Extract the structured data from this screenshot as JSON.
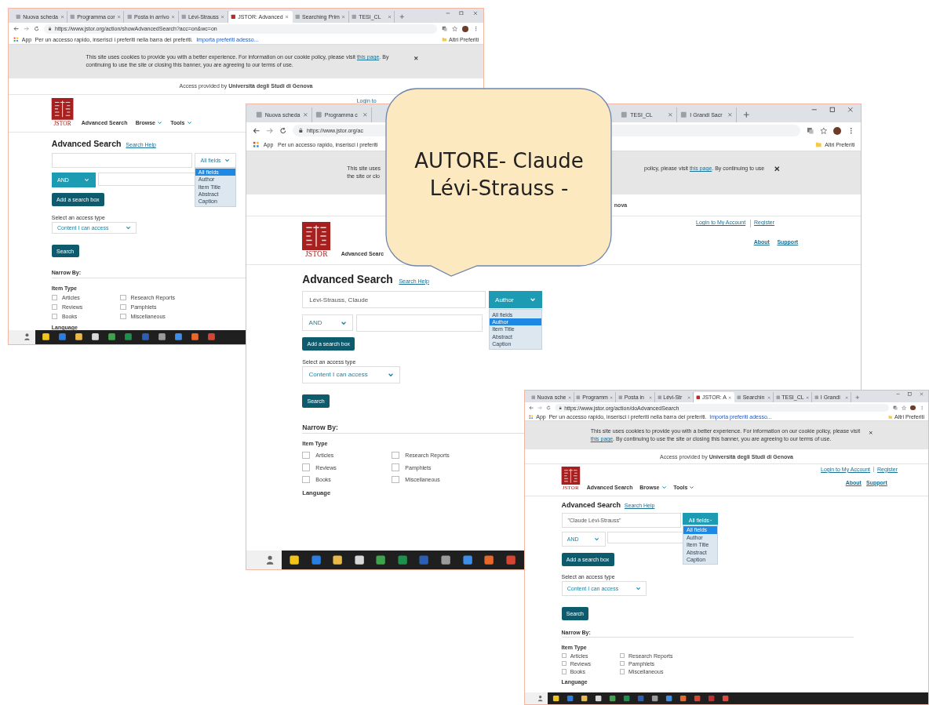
{
  "windows": [
    {
      "tabs": [
        {
          "title": "Nuova scheda",
          "selected": false
        },
        {
          "title": "Programma cor",
          "selected": false
        },
        {
          "title": "Posta in arrivo",
          "selected": false
        },
        {
          "title": "Lévi-Strauss",
          "selected": false
        },
        {
          "title": "JSTOR: Advanced",
          "selected": true
        },
        {
          "title": "Searching Prim",
          "selected": false
        },
        {
          "title": "TESI_CL",
          "selected": false
        }
      ],
      "url": "https://www.jstor.org/action/showAdvancedSearch?acc=on&wc=on",
      "bookmarks": {
        "apps": "App",
        "hint": "Per un accesso rapido, inserisci i preferiti nella barra dei preferiti.",
        "import_link": "Importa preferiti adesso...",
        "other": "Altri Preferiti"
      },
      "banner": {
        "paragraphs": [
          {
            "parts": [
              {
                "kind": "text",
                "text": "This site uses cookies to provide you with a better experience. For information on our cookie policy, please visit "
              },
              {
                "kind": "link",
                "text": "this page"
              },
              {
                "kind": "text",
                "text": ". By continuing to use the site or closing this banner, you are agreeing to our terms of use."
              }
            ]
          }
        ]
      },
      "access": "Access provided by **Università degli Studi di Genova**",
      "logo_text": "JSTOR",
      "nav": [
        {
          "label": "Advanced Search",
          "menu": false
        },
        {
          "label": "Browse",
          "menu": true
        },
        {
          "label": "Tools",
          "menu": true
        }
      ],
      "account_links": [
        "Login to"
      ],
      "heading": "Advanced Search",
      "help_link": "Search Help",
      "field_select": {
        "value": "All fields",
        "focused": false,
        "open": true,
        "options": [
          {
            "label": "All fields",
            "selected": true
          },
          {
            "label": "Author",
            "selected": false
          },
          {
            "label": "Item Title",
            "selected": false
          },
          {
            "label": "Abstract",
            "selected": false
          },
          {
            "label": "Caption",
            "selected": false
          }
        ]
      },
      "operator_select": {
        "value": "AND",
        "focused": true
      },
      "add_button": "Add a search box",
      "access_label": "Select an access type",
      "access_select": "Content I can access",
      "search_button": "Search",
      "narrow_by": "Narrow By:",
      "item_type_label": "Item Type",
      "item_types": [
        {
          "label": "Articles",
          "checked": false
        },
        {
          "label": "Reviews",
          "checked": false
        },
        {
          "label": "Books",
          "checked": false
        },
        {
          "label": "Research Reports",
          "checked": false
        },
        {
          "label": "Pamphlets",
          "checked": false
        },
        {
          "label": "Miscellaneous",
          "checked": false
        }
      ],
      "language_label": "Language"
    },
    {
      "tabs": [
        {
          "title": "Nuova scheda",
          "selected": false
        },
        {
          "title": "Programma c",
          "selected": false
        },
        {
          "title": "TESI_CL",
          "selected": false
        },
        {
          "title": "I Grandi Sacr",
          "selected": false
        }
      ],
      "url": "https://www.jstor.org/ac",
      "bookmarks": {
        "apps": "App",
        "hint": "Per un accesso rapido, inserisci i preferiti",
        "other": "Altri Preferiti"
      },
      "banner": {
        "paragraphs": [
          {
            "parts": [
              {
                "kind": "text",
                "text": "This site uses"
              }
            ]
          },
          {
            "parts": [
              {
                "kind": "text",
                "text": "policy, please visit "
              },
              {
                "kind": "link",
                "text": "this page"
              },
              {
                "kind": "text",
                "text": ". By continuing to use"
              }
            ]
          },
          {
            "parts": [
              {
                "kind": "text",
                "text": "the site or clo"
              }
            ]
          }
        ]
      },
      "access": "**nova**",
      "logo_text": "JSTOR",
      "nav": [
        {
          "label": "Advanced Searc",
          "menu": false
        }
      ],
      "account_links": [
        "Login to My Account",
        "Register"
      ],
      "info_links": [
        "About",
        "Support"
      ],
      "heading": "Advanced Search",
      "help_link": "Search Help",
      "query": "Lévi-Strauss, Claude",
      "field_select": {
        "value": "Author",
        "focused": true,
        "open": true,
        "options": [
          {
            "label": "All fields",
            "selected": false
          },
          {
            "label": "Author",
            "selected": true
          },
          {
            "label": "Item Title",
            "selected": false
          },
          {
            "label": "Abstract",
            "selected": false
          },
          {
            "label": "Caption",
            "selected": false
          }
        ]
      },
      "operator_select": {
        "value": "AND",
        "focused": false
      },
      "add_button": "Add a search box",
      "access_label": "Select an access type",
      "access_select": "Content I can access",
      "search_button": "Search",
      "narrow_by": "Narrow By:",
      "item_type_label": "Item Type",
      "item_types": [
        {
          "label": "Articles",
          "checked": false
        },
        {
          "label": "Reviews",
          "checked": false
        },
        {
          "label": "Books",
          "checked": false
        },
        {
          "label": "Research Reports",
          "checked": false
        },
        {
          "label": "Pamphlets",
          "checked": false
        },
        {
          "label": "Miscellaneous",
          "checked": false
        }
      ],
      "language_label": "Language"
    },
    {
      "tabs": [
        {
          "title": "Nuova sche",
          "selected": false
        },
        {
          "title": "Programm",
          "selected": false
        },
        {
          "title": "Posta in",
          "selected": false
        },
        {
          "title": "Lévi-Str",
          "selected": false
        },
        {
          "title": "JSTOR: A",
          "selected": true
        },
        {
          "title": "Searchin",
          "selected": false
        },
        {
          "title": "TESI_CL",
          "selected": false
        },
        {
          "title": "I Grandi",
          "selected": false
        }
      ],
      "url": "https://www.jstor.org/action/doAdvancedSearch",
      "bookmarks": {
        "apps": "App",
        "hint": "Per un accesso rapido, inserisci i preferiti nella barra dei preferiti.",
        "import_link": "Importa preferiti adesso...",
        "other": "Altri Preferiti"
      },
      "banner": {
        "paragraphs": [
          {
            "parts": [
              {
                "kind": "text",
                "text": "This site uses cookies to provide you with a better experience. For information on our cookie policy, please visit "
              },
              {
                "kind": "link",
                "text": "this page"
              },
              {
                "kind": "text",
                "text": ". By continuing to use the site or closing this banner, you are agreeing to our terms of use."
              }
            ]
          }
        ]
      },
      "access": "Access provided by **Università degli Studi di Genova**",
      "logo_text": "JSTOR",
      "nav": [
        {
          "label": "Advanced Search",
          "menu": false
        },
        {
          "label": "Browse",
          "menu": true
        },
        {
          "label": "Tools",
          "menu": true
        }
      ],
      "account_links": [
        "Login to My Account",
        "Register"
      ],
      "info_links": [
        "About",
        "Support"
      ],
      "heading": "Advanced Search",
      "help_link": "Search Help",
      "query": "\"Claude Lévi-Strauss\"",
      "field_select": {
        "value": "All fields",
        "focused": true,
        "open": true,
        "options": [
          {
            "label": "All fields",
            "selected": true
          },
          {
            "label": "Author",
            "selected": false
          },
          {
            "label": "Item Title",
            "selected": false
          },
          {
            "label": "Abstract",
            "selected": false
          },
          {
            "label": "Caption",
            "selected": false
          }
        ]
      },
      "operator_select": {
        "value": "AND",
        "focused": false
      },
      "add_button": "Add a search box",
      "access_label": "Select an access type",
      "access_select": "Content I can access",
      "search_button": "Search",
      "narrow_by": "Narrow By:",
      "item_type_label": "Item Type",
      "item_types": [
        {
          "label": "Articles",
          "checked": false
        },
        {
          "label": "Reviews",
          "checked": false
        },
        {
          "label": "Books",
          "checked": false
        },
        {
          "label": "Research Reports",
          "checked": false
        },
        {
          "label": "Pamphlets",
          "checked": false
        },
        {
          "label": "Miscellaneous",
          "checked": false
        }
      ],
      "language_label": "Language"
    }
  ],
  "callout": {
    "text": "AUTORE- Claude Lévi-Strauss -"
  }
}
